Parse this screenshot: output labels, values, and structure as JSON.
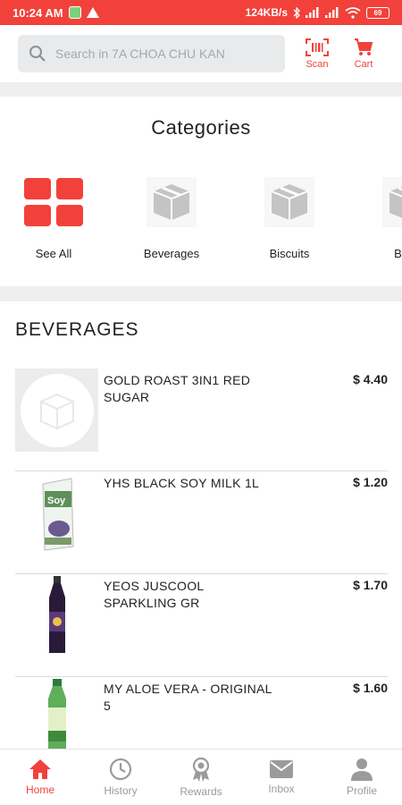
{
  "status_bar": {
    "time": "10:24 AM",
    "speed": "124KB/s",
    "battery": "69"
  },
  "header": {
    "search_placeholder": "Search in 7A CHOA CHU KAN",
    "scan_label": "Scan",
    "cart_label": "Cart"
  },
  "categories": {
    "title": "Categories",
    "items": [
      {
        "label": "See All",
        "icon": "grid-icon"
      },
      {
        "label": "Beverages",
        "icon": "box-icon"
      },
      {
        "label": "Biscuits",
        "icon": "box-icon"
      },
      {
        "label": "Body",
        "icon": "box-icon"
      }
    ]
  },
  "section": {
    "title": "BEVERAGES",
    "products": [
      {
        "name": "GOLD ROAST 3IN1 RED SUGAR",
        "price": "$ 4.40",
        "image": "placeholder-box"
      },
      {
        "name": "YHS BLACK SOY MILK 1L",
        "price": "$ 1.20",
        "image": "soy-milk-carton"
      },
      {
        "name": "YEOS JUSCOOL SPARKLING GR",
        "price": "$ 1.70",
        "image": "grape-drink-bottle"
      },
      {
        "name": "MY ALOE VERA - ORIGINAL 5",
        "price": "$ 1.60",
        "image": "aloe-vera-bottle"
      }
    ]
  },
  "bottom_nav": [
    {
      "label": "Home",
      "icon": "home-icon",
      "active": true
    },
    {
      "label": "History",
      "icon": "clock-icon",
      "active": false
    },
    {
      "label": "Rewards",
      "icon": "medal-icon",
      "active": false
    },
    {
      "label": "Inbox",
      "icon": "mail-icon",
      "active": false
    },
    {
      "label": "Profile",
      "icon": "person-icon",
      "active": false
    }
  ],
  "colors": {
    "accent": "#f2413a",
    "inactive": "#9b9b9b",
    "placeholder_grey": "#cfcfcf"
  }
}
